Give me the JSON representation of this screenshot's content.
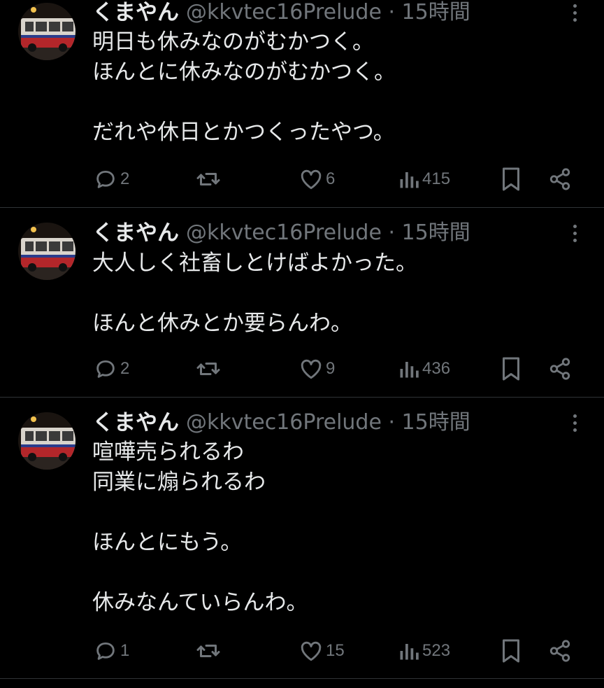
{
  "tweets": [
    {
      "name": "くまやん",
      "meta": "@kkvtec16Prelude · 15時間",
      "text": "明日も休みなのがむかつく。\nほんとに休みなのがむかつく。\n\nだれや休日とかつくったやつ。",
      "replies": "2",
      "likes": "6",
      "views": "415"
    },
    {
      "name": "くまやん",
      "meta": "@kkvtec16Prelude · 15時間",
      "text": "大人しく社畜しとけばよかった。\n\nほんと休みとか要らんわ。",
      "replies": "2",
      "likes": "9",
      "views": "436"
    },
    {
      "name": "くまやん",
      "meta": "@kkvtec16Prelude · 15時間",
      "text": "喧嘩売られるわ\n同業に煽られるわ\n\nほんとにもう。\n\n休みなんていらんわ。",
      "replies": "1",
      "likes": "15",
      "views": "523"
    }
  ],
  "icons": {
    "reply": "reply-icon",
    "retweet": "retweet-icon",
    "like": "heart-icon",
    "views": "views-icon",
    "bookmark": "bookmark-icon",
    "share": "share-icon",
    "more": "more-icon"
  },
  "colors": {
    "background": "#000000",
    "text": "#e7e9ea",
    "secondary": "#71767b",
    "divider": "#2f3336"
  }
}
